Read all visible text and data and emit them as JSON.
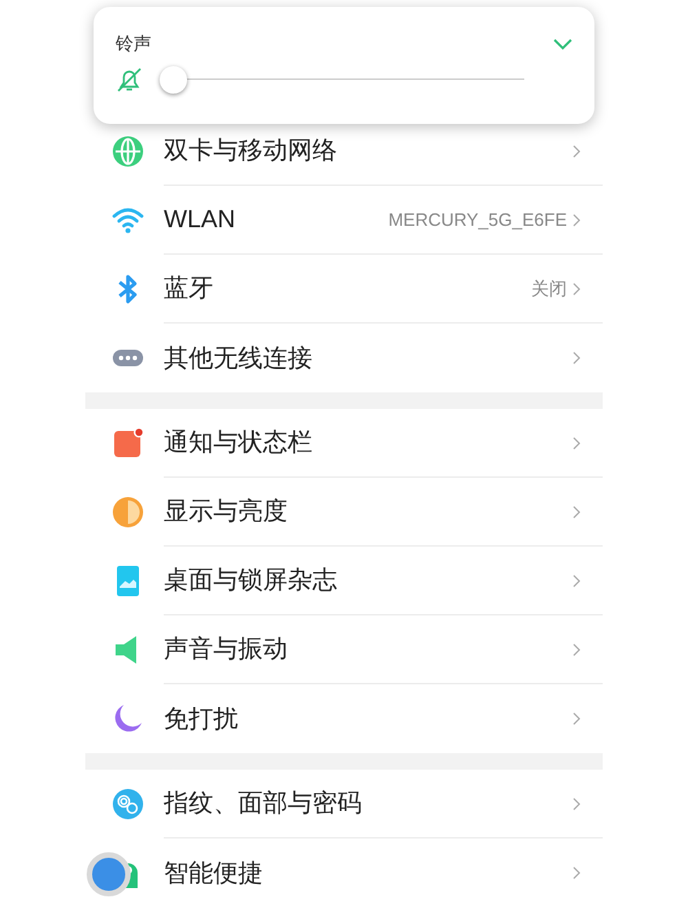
{
  "ringtone_popup": {
    "title": "铃声",
    "expanded": false,
    "muted": true,
    "level": 0
  },
  "sections": [
    {
      "items": [
        {
          "kind": "network",
          "label": "双卡与移动网络"
        },
        {
          "kind": "wlan",
          "label": "WLAN",
          "value": "MERCURY_5G_E6FE"
        },
        {
          "kind": "bluetooth",
          "label": "蓝牙",
          "value": "关闭"
        },
        {
          "kind": "more",
          "label": "其他无线连接"
        }
      ]
    },
    {
      "items": [
        {
          "kind": "notification",
          "label": "通知与状态栏"
        },
        {
          "kind": "display",
          "label": "显示与亮度"
        },
        {
          "kind": "wallpaper",
          "label": "桌面与锁屏杂志"
        },
        {
          "kind": "sound",
          "label": "声音与振动"
        },
        {
          "kind": "dnd",
          "label": "免打扰"
        }
      ]
    },
    {
      "items": [
        {
          "kind": "security",
          "label": "指纹、面部与密码"
        },
        {
          "kind": "smart",
          "label": "智能便捷"
        }
      ]
    }
  ]
}
